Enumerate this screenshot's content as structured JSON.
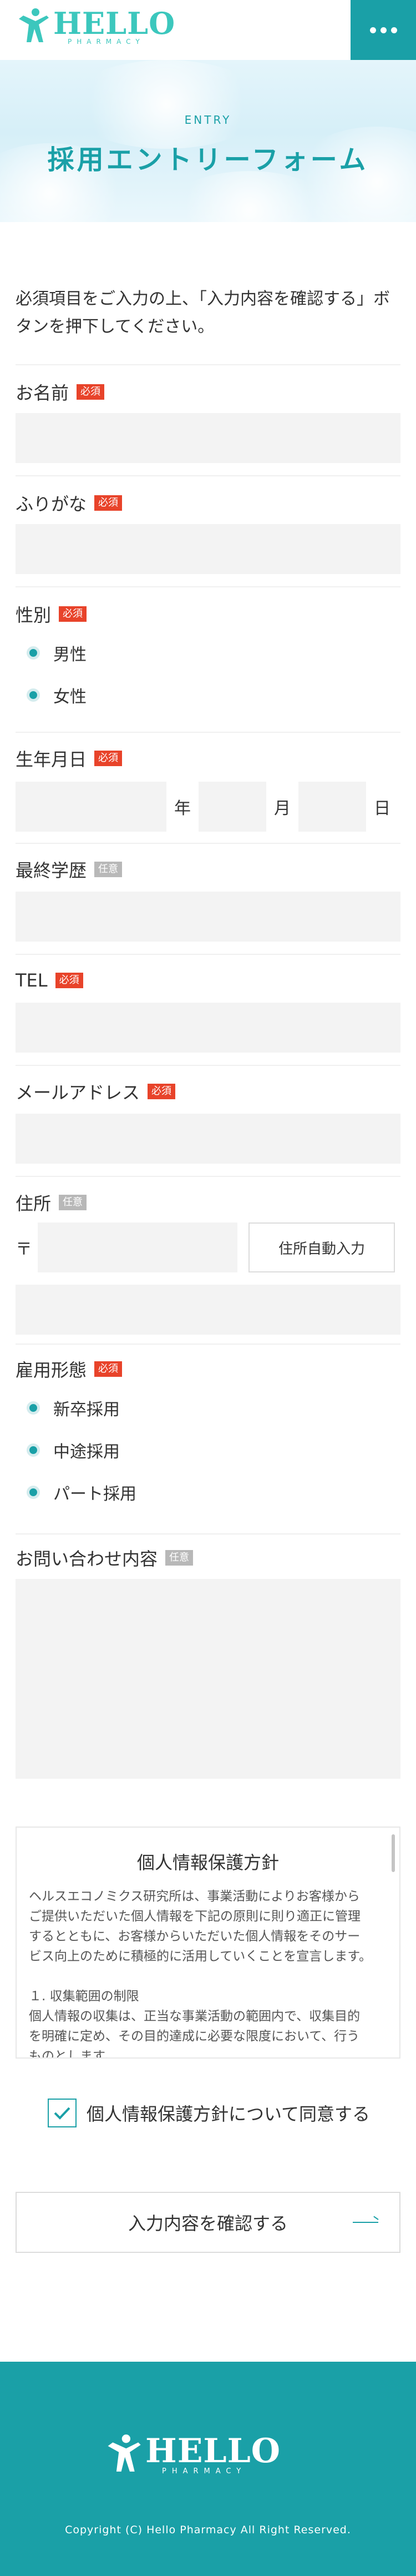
{
  "header": {
    "logo_text": "HELLO",
    "logo_sub": "PHARMACY",
    "menu_icon": "more-dots-icon"
  },
  "hero": {
    "en": "ENTRY",
    "title": "採用エントリーフォーム"
  },
  "intro": "必須項目をご入力の上、「入力内容を確認する」ボタンを押下してください。",
  "badges": {
    "required": "必須",
    "optional": "任意"
  },
  "fields": {
    "name": {
      "label": "お名前",
      "value": ""
    },
    "kana": {
      "label": "ふりがな",
      "value": ""
    },
    "gender": {
      "label": "性別",
      "options": [
        "男性",
        "女性"
      ]
    },
    "birth": {
      "label": "生年月日",
      "year": "年",
      "month": "月",
      "day": "日"
    },
    "education": {
      "label": "最終学歴",
      "value": ""
    },
    "tel": {
      "label": "TEL",
      "value": ""
    },
    "email": {
      "label": "メールアドレス",
      "value": ""
    },
    "address": {
      "label": "住所",
      "postal_mark": "〒",
      "auto_button": "住所自動入力"
    },
    "employment": {
      "label": "雇用形態",
      "options": [
        "新卒採用",
        "中途採用",
        "パート採用"
      ]
    },
    "inquiry": {
      "label": "お問い合わせ内容",
      "value": ""
    }
  },
  "privacy": {
    "title": "個人情報保護方針",
    "paragraph": "ヘルスエコノミクス研究所は、事業活動によりお客様からご提供いただいた個人情報を下記の原則に則り適正に管理するとともに、お客様からいただいた個人情報をそのサービス向上のために積極的に活用していくことを宣言します。",
    "section_title": "１. 収集範囲の制限",
    "section_text": "個人情報の収集は、正当な事業活動の範囲内で、収集目的を明確に定め、その目的達成に必要な限度において、行うものとします。"
  },
  "agree_label": "個人情報保護方針について同意する",
  "submit_label": "入力内容を確認する",
  "footer": {
    "logo_text": "HELLO",
    "logo_sub": "PHARMACY",
    "copyright": "Copyright (C) Hello Pharmacy All Right Reserved."
  },
  "colors": {
    "accent": "#1aa0a7",
    "logo": "#3cc7bd",
    "required": "#e8432a",
    "optional": "#b8b8b8",
    "input_bg": "#f3f3f3"
  }
}
